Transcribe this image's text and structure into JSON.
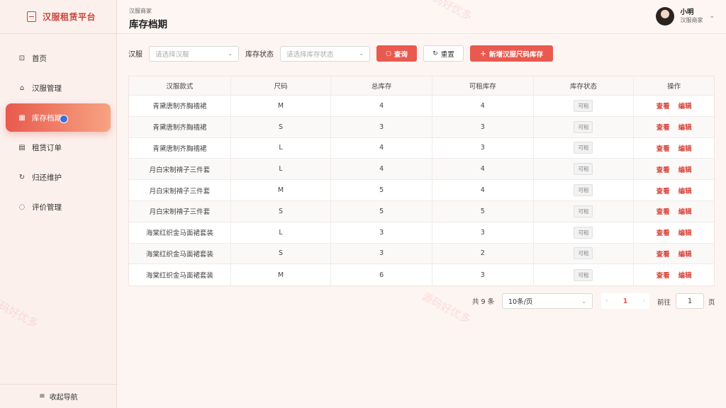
{
  "app": {
    "title": "汉服租赁平台"
  },
  "sidebar": {
    "items": [
      {
        "label": "首页",
        "icon": "dashboard-icon"
      },
      {
        "label": "汉服管理",
        "icon": "bag-icon"
      },
      {
        "label": "库存档期",
        "icon": "calendar-icon",
        "active": true
      },
      {
        "label": "租赁订单",
        "icon": "document-icon"
      },
      {
        "label": "归还维护",
        "icon": "refresh-icon"
      },
      {
        "label": "评价管理",
        "icon": "chat-icon"
      }
    ],
    "collapse_label": "收起导航"
  },
  "header": {
    "breadcrumb": "汉服商家",
    "title": "库存档期",
    "user": {
      "name": "小明",
      "role": "汉服商家"
    }
  },
  "filters": {
    "hanfu_label": "汉服",
    "hanfu_placeholder": "请选择汉服",
    "status_label": "库存状态",
    "status_placeholder": "请选择库存状态",
    "query_label": "查询",
    "reset_label": "重置",
    "add_label": "新增汉服尺码库存"
  },
  "table": {
    "headers": [
      "汉服款式",
      "尺码",
      "总库存",
      "可租库存",
      "库存状态",
      "操作"
    ],
    "view_label": "查看",
    "edit_label": "编辑",
    "rows": [
      {
        "style": "青黛唐制齐胸襦裙",
        "size": "M",
        "total": "4",
        "available": "4",
        "status": "可租"
      },
      {
        "style": "青黛唐制齐胸襦裙",
        "size": "S",
        "total": "3",
        "available": "3",
        "status": "可租"
      },
      {
        "style": "青黛唐制齐胸襦裙",
        "size": "L",
        "total": "4",
        "available": "3",
        "status": "可租"
      },
      {
        "style": "月白宋制褙子三件套",
        "size": "L",
        "total": "4",
        "available": "4",
        "status": "可租"
      },
      {
        "style": "月白宋制褙子三件套",
        "size": "M",
        "total": "5",
        "available": "4",
        "status": "可租"
      },
      {
        "style": "月白宋制褙子三件套",
        "size": "S",
        "total": "5",
        "available": "5",
        "status": "可租"
      },
      {
        "style": "海棠红织金马面裙套装",
        "size": "L",
        "total": "3",
        "available": "3",
        "status": "可租"
      },
      {
        "style": "海棠红织金马面裙套装",
        "size": "S",
        "total": "3",
        "available": "2",
        "status": "可租"
      },
      {
        "style": "海棠红织金马面裙套装",
        "size": "M",
        "total": "6",
        "available": "3",
        "status": "可租"
      }
    ]
  },
  "pagination": {
    "total_text": "共 9 条",
    "page_size": "10条/页",
    "current_page": "1",
    "goto_label": "前往",
    "goto_value": "1",
    "goto_suffix": "页"
  },
  "watermark": "源码好优多",
  "colors": {
    "accent": "#e85a4f",
    "brand_text": "#c8453b"
  }
}
